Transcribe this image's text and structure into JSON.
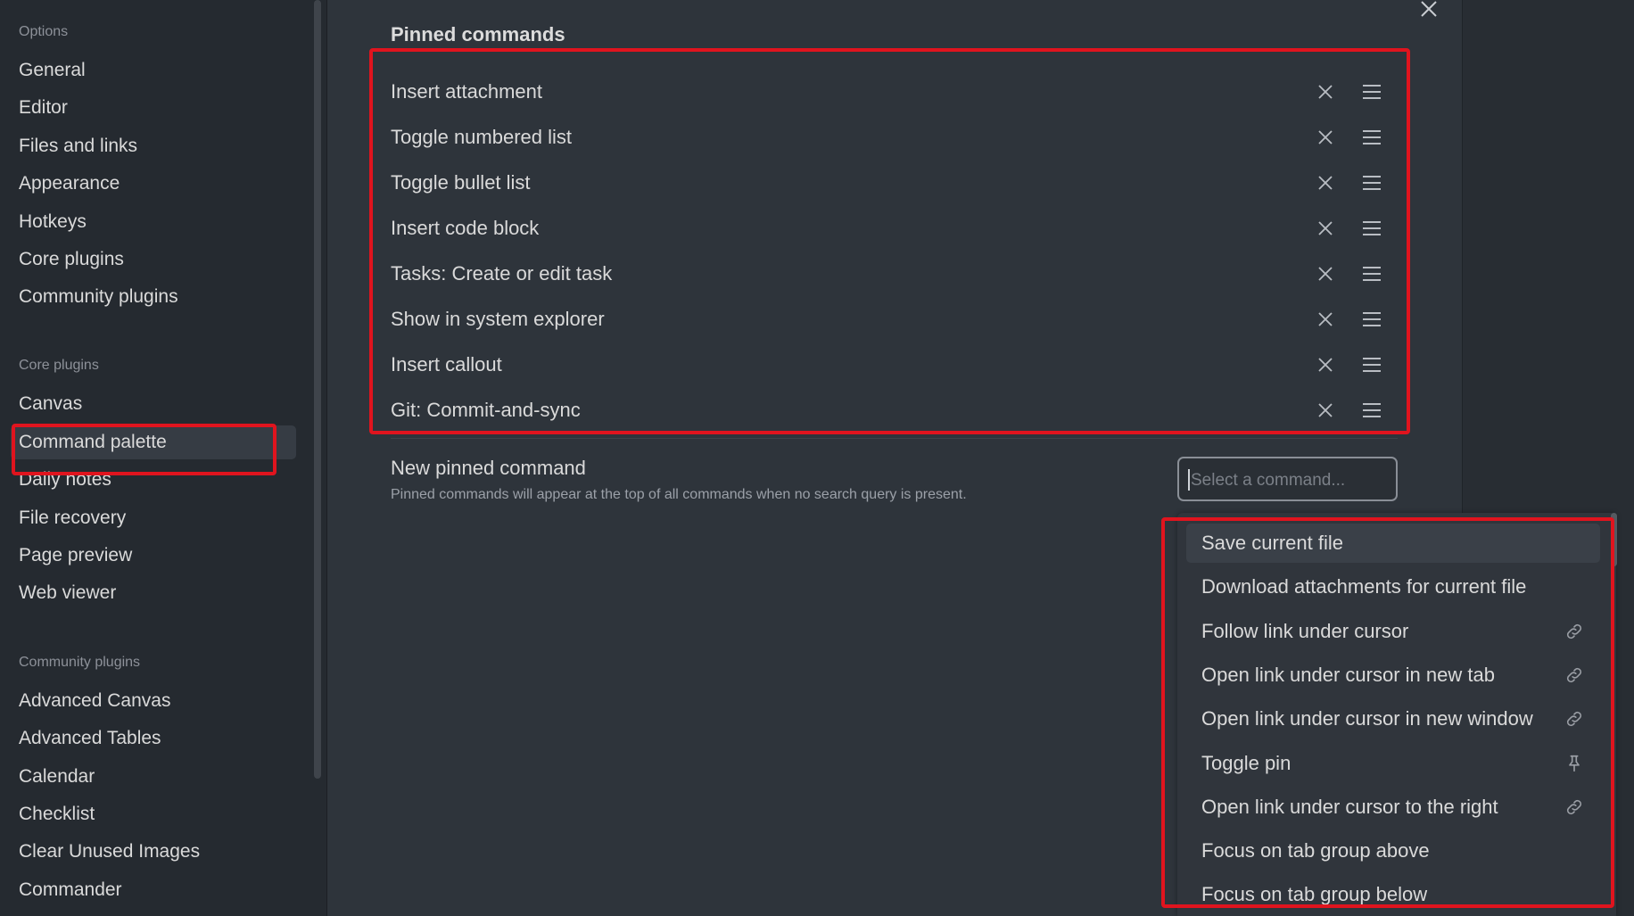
{
  "sidebar": {
    "sections": [
      {
        "header": "Options",
        "items": [
          "General",
          "Editor",
          "Files and links",
          "Appearance",
          "Hotkeys",
          "Core plugins",
          "Community plugins"
        ]
      },
      {
        "header": "Core plugins",
        "items": [
          "Canvas",
          "Command palette",
          "Daily notes",
          "File recovery",
          "Page preview",
          "Web viewer"
        ]
      },
      {
        "header": "Community plugins",
        "items": [
          "Advanced Canvas",
          "Advanced Tables",
          "Calendar",
          "Checklist",
          "Clear Unused Images",
          "Commander"
        ]
      }
    ],
    "active_item": "Command palette"
  },
  "main": {
    "section_title": "Pinned commands",
    "pinned_commands": [
      "Insert attachment",
      "Toggle numbered list",
      "Toggle bullet list",
      "Insert code block",
      "Tasks: Create or edit task",
      "Show in system explorer",
      "Insert callout",
      "Git: Commit-and-sync"
    ],
    "new_pinned": {
      "name": "New pinned command",
      "description": "Pinned commands will appear at the top of all commands when no search query is present.",
      "placeholder": "Select a command..."
    }
  },
  "dropdown": {
    "items": [
      {
        "label": "Save current file",
        "icon": null
      },
      {
        "label": "Download attachments for current file",
        "icon": null
      },
      {
        "label": "Follow link under cursor",
        "icon": "link-icon"
      },
      {
        "label": "Open link under cursor in new tab",
        "icon": "link-icon"
      },
      {
        "label": "Open link under cursor in new window",
        "icon": "link-icon"
      },
      {
        "label": "Toggle pin",
        "icon": "pin-icon"
      },
      {
        "label": "Open link under cursor to the right",
        "icon": "link-icon"
      },
      {
        "label": "Focus on tab group above",
        "icon": null
      },
      {
        "label": "Focus on tab group below",
        "icon": null
      }
    ],
    "selected_index": 0
  },
  "colors": {
    "highlight": "#e0141e",
    "background": "#2e343b",
    "sidebar": "#252a30",
    "text": "#dadada"
  }
}
